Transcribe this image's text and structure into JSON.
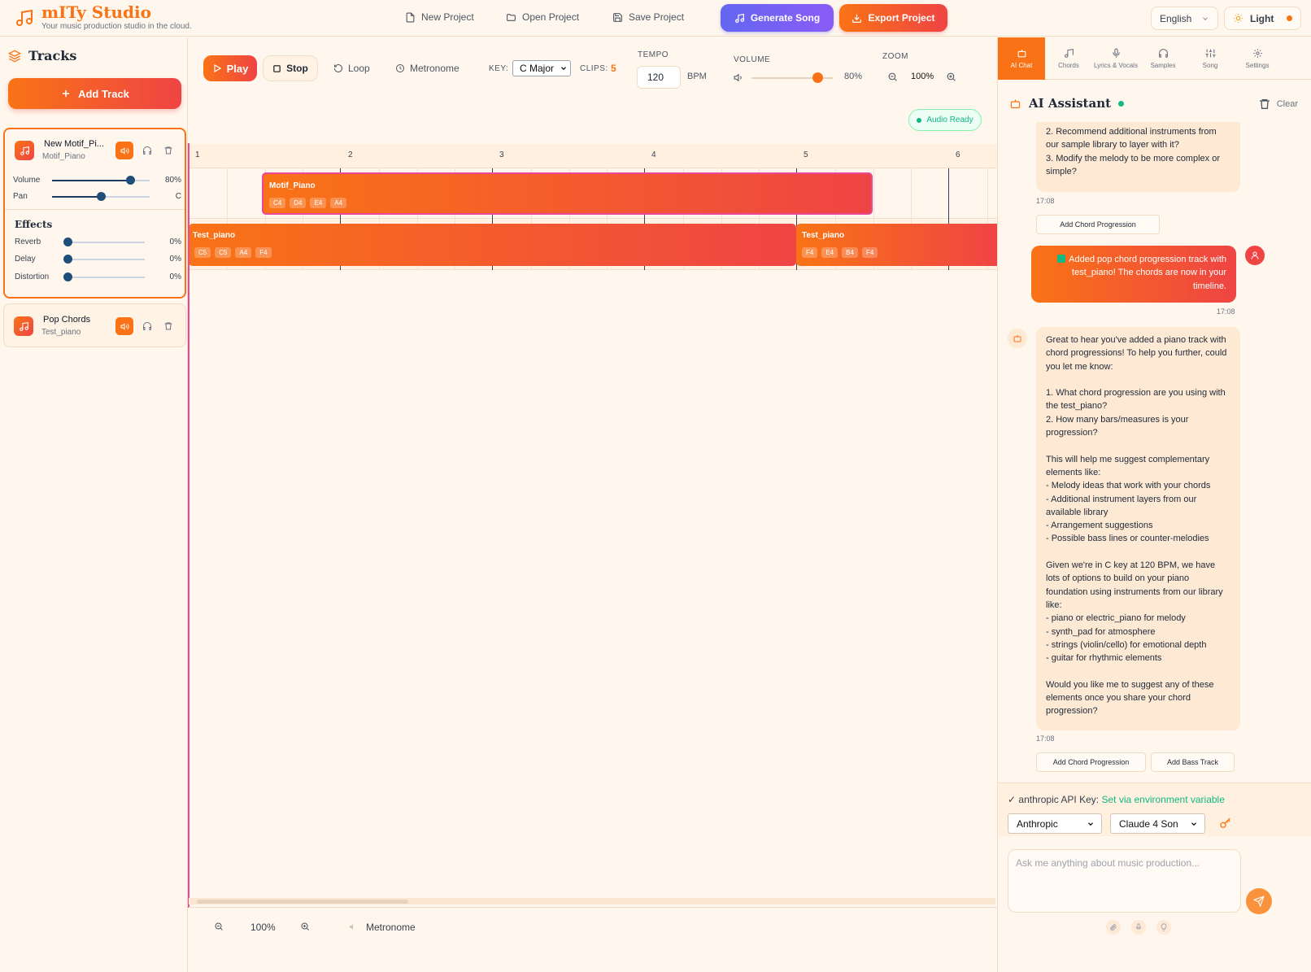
{
  "app": {
    "title": "mITy Studio",
    "subtitle": "Your music production studio in the cloud."
  },
  "header": {
    "new_project": "New Project",
    "open_project": "Open Project",
    "save_project": "Save Project",
    "generate_song": "Generate Song",
    "export_project": "Export Project",
    "language": "English",
    "theme": "Light"
  },
  "sidebar": {
    "title": "Tracks",
    "add_track": "Add Track",
    "tracks": [
      {
        "name": "New Motif_Pi...",
        "instrument": "Motif_Piano",
        "volume_label": "Volume",
        "volume_value": "80%",
        "volume": 0.8,
        "pan_label": "Pan",
        "pan_value": "C",
        "pan": 0.5,
        "effects_title": "Effects",
        "effects": [
          {
            "label": "Reverb",
            "value": "0%"
          },
          {
            "label": "Delay",
            "value": "0%"
          },
          {
            "label": "Distortion",
            "value": "0%"
          }
        ]
      },
      {
        "name": "Pop Chords",
        "instrument": "Test_piano"
      }
    ]
  },
  "transport": {
    "play": "Play",
    "stop": "Stop",
    "loop": "Loop",
    "metronome": "Metronome",
    "key_label": "KEY:",
    "key_value": "C Major",
    "clips_label": "CLIPS:",
    "clips_value": "5",
    "tempo_label": "TEMPO",
    "tempo_value": "120",
    "tempo_unit": "BPM",
    "volume_label": "VOLUME",
    "volume_value": "80%",
    "volume": 0.8,
    "zoom_label": "ZOOM",
    "zoom_value": "100%",
    "audio_status": "Audio Ready"
  },
  "timeline": {
    "bars": [
      "1",
      "2",
      "3",
      "4",
      "5",
      "6"
    ],
    "clips": [
      {
        "name": "Motif_Piano",
        "notes": [
          "C4",
          "D4",
          "E4",
          "A4"
        ]
      },
      {
        "name": "Test_piano",
        "notes": [
          "C5",
          "C5",
          "A4",
          "F4"
        ]
      },
      {
        "name": "Test_piano",
        "notes": [
          "F4",
          "E4",
          "B4",
          "F4"
        ]
      }
    ]
  },
  "bottombar": {
    "zoom_value": "100%",
    "metronome": "Metronome"
  },
  "panel": {
    "tabs": [
      "AI Chat",
      "Chords",
      "Lyrics & Vocals",
      "Samples",
      "Song",
      "Settings"
    ],
    "assistant_title": "AI Assistant",
    "clear": "Clear",
    "messages": {
      "m1_text": "2. Recommend additional instruments from our sample library to layer with it?\n3. Modify the melody to be more complex or simple?",
      "m1_time": "17:08",
      "m1_chip": "Add Chord Progression",
      "user_text": "Added pop chord progression track with test_piano! The chords are now in your timeline.",
      "user_time": "17:08",
      "m2_text": "Great to hear you've added a piano track with chord progressions! To help you further, could you let me know:\n\n1. What chord progression are you using with the test_piano?\n2. How many bars/measures is your progression?\n\nThis will help me suggest complementary elements like:\n- Melody ideas that work with your chords\n- Additional instrument layers from our available library\n- Arrangement suggestions\n- Possible bass lines or counter-melodies\n\nGiven we're in C key at 120 BPM, we have lots of options to build on your piano foundation using instruments from our library like:\n- piano or electric_piano for melody\n- synth_pad for atmosphere\n- strings (violin/cello) for emotional depth\n- guitar for rhythmic elements\n\nWould you like me to suggest any of these elements once you share your chord progression?",
      "m2_time": "17:08",
      "m2_chip1": "Add Chord Progression",
      "m2_chip2": "Add Bass Track"
    },
    "api_prefix": "✓ anthropic API Key:",
    "api_status": "Set via environment variable",
    "provider": "Anthropic",
    "model": "Claude 4 Son",
    "input_placeholder": "Ask me anything about music production..."
  },
  "colors": {
    "accent": "#f97316",
    "accent2": "#ef4444",
    "generate": "#6366f1",
    "ok": "#10b981",
    "playhead": "#ec4899"
  }
}
